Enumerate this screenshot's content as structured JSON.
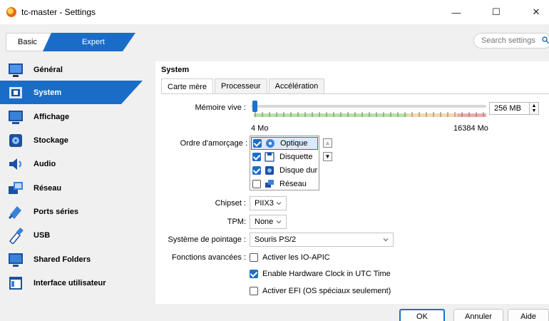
{
  "window": {
    "title": "tc-master - Settings",
    "minimize": "—",
    "maximize": "☐",
    "close": "✕"
  },
  "mode": {
    "basic": "Basic",
    "expert": "Expert"
  },
  "search": {
    "placeholder": "Search settings"
  },
  "sidebar": {
    "items": [
      {
        "label": "Général",
        "icon": "general-icon"
      },
      {
        "label": "System",
        "icon": "system-icon",
        "active": true
      },
      {
        "label": "Affichage",
        "icon": "display-icon"
      },
      {
        "label": "Stockage",
        "icon": "storage-icon"
      },
      {
        "label": "Audio",
        "icon": "audio-icon"
      },
      {
        "label": "Réseau",
        "icon": "network-icon"
      },
      {
        "label": "Ports séries",
        "icon": "serial-ports-icon"
      },
      {
        "label": "USB",
        "icon": "usb-icon"
      },
      {
        "label": "Shared Folders",
        "icon": "shared-folders-icon"
      },
      {
        "label": "Interface utilisateur",
        "icon": "user-interface-icon"
      }
    ]
  },
  "section": {
    "title": "System"
  },
  "tabs": [
    {
      "label": "Carte mère",
      "active": true
    },
    {
      "label": "Processeur"
    },
    {
      "label": "Accélération"
    }
  ],
  "memory": {
    "label": "Mémoire vive :",
    "value": "256 MB",
    "min": "4 Mo",
    "max": "16384 Mo"
  },
  "boot": {
    "label": "Ordre d'amorçage :",
    "items": [
      {
        "label": "Optique",
        "checked": true
      },
      {
        "label": "Disquette",
        "checked": true
      },
      {
        "label": "Disque dur",
        "checked": true
      },
      {
        "label": "Réseau",
        "checked": false
      }
    ]
  },
  "chipset": {
    "label": "Chipset :",
    "value": "PIIX3"
  },
  "tpm": {
    "label": "TPM:",
    "value": "None"
  },
  "pointing": {
    "label": "Système de pointage :",
    "value": "Souris PS/2"
  },
  "features": {
    "label": "Fonctions avancées :",
    "ioapic": "Activer les IO-APIC",
    "utc": "Enable Hardware Clock in UTC Time",
    "efi": "Activer EFI (OS spéciaux seulement)"
  },
  "buttons": {
    "ok": "OK",
    "cancel": "Annuler",
    "help": "Aide"
  },
  "colors": {
    "accent": "#1f6fc4",
    "selection": "#1a6dc7"
  }
}
